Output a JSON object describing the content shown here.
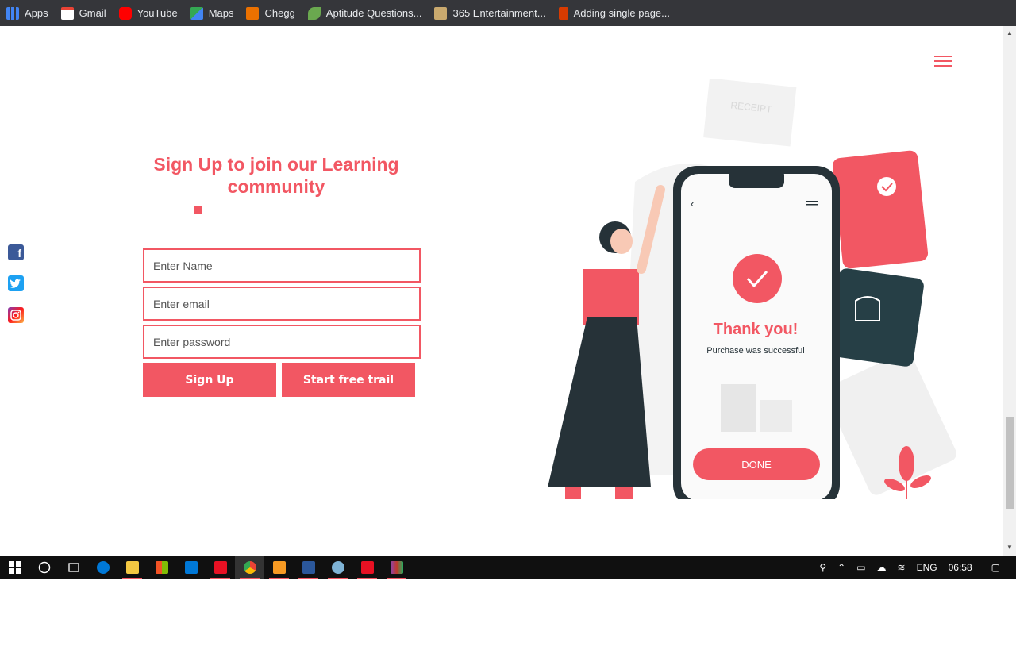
{
  "bookmarks": [
    {
      "label": "Apps",
      "icon": "apps-grid-icon",
      "color": "#4285f4"
    },
    {
      "label": "Gmail",
      "icon": "gmail-icon",
      "color": "#ea4335"
    },
    {
      "label": "YouTube",
      "icon": "youtube-icon",
      "color": "#ff0000"
    },
    {
      "label": "Maps",
      "icon": "maps-icon",
      "color": "#34a853"
    },
    {
      "label": "Chegg",
      "icon": "chegg-icon",
      "color": "#eb7100"
    },
    {
      "label": "Aptitude Questions...",
      "icon": "aptitude-icon",
      "color": "#6aa84f"
    },
    {
      "label": "365 Entertainment...",
      "icon": "365-icon",
      "color": "#c9a96e"
    },
    {
      "label": "Adding single page...",
      "icon": "office-icon",
      "color": "#d83b01"
    }
  ],
  "page": {
    "title": "Sign Up to join our Learning community",
    "fields": {
      "name_placeholder": "Enter Name",
      "email_placeholder": "Enter email",
      "password_placeholder": "Enter password"
    },
    "buttons": {
      "signup": "Sign Up",
      "trial": "Start free trail"
    },
    "accent": "#f25763",
    "illustration": {
      "thank_you": "Thank you!",
      "purchase_text": "Purchase was successful",
      "done": "DONE",
      "receipt": "RECEIPT"
    }
  },
  "social": [
    {
      "name": "facebook",
      "icon": "facebook-icon"
    },
    {
      "name": "twitter",
      "icon": "twitter-icon"
    },
    {
      "name": "instagram",
      "icon": "instagram-icon"
    }
  ],
  "taskbar": {
    "language": "ENG",
    "time": "06:58"
  }
}
